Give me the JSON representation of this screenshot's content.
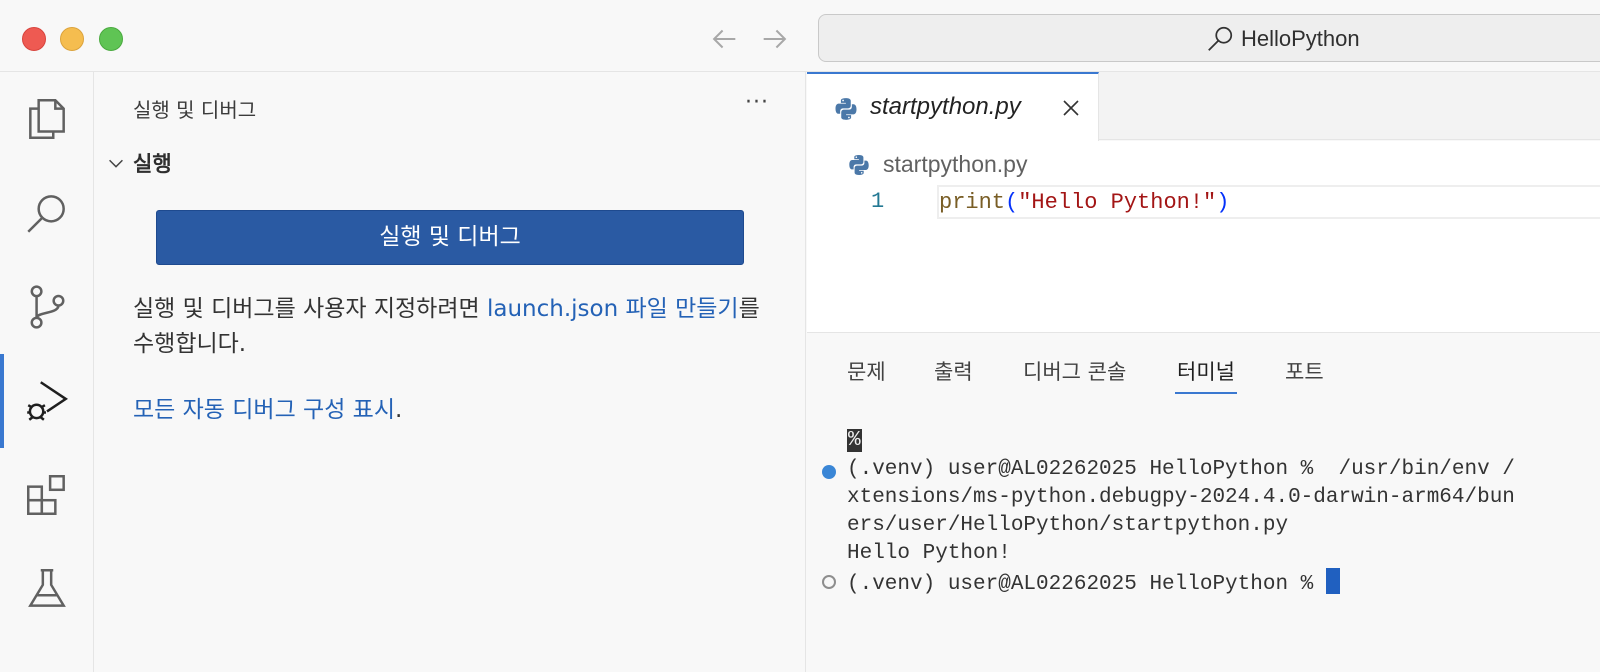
{
  "window": {
    "command_center_text": "HelloPython"
  },
  "activity_bar": {
    "items": [
      "explorer-icon",
      "search-icon",
      "source-control-icon",
      "run-debug-icon",
      "extensions-icon",
      "testing-icon"
    ],
    "active": "run-debug-icon"
  },
  "sidebar": {
    "title": "실행 및 디버그",
    "more": "···",
    "section_label": "실행",
    "run_button": "실행 및 디버그",
    "desc_pre": "실행 및 디버그를 사용자 지정하려면 ",
    "desc_link": "launch.json 파일 만들기",
    "desc_post": "를 수행합니다.",
    "auto_link": "모든 자동 디버그 구성 표시",
    "auto_post": "."
  },
  "editor": {
    "tab_name": "startpython.py",
    "breadcrumb": "startpython.py",
    "line_number": "1",
    "code": {
      "fn": "print",
      "open": "(",
      "str": "\"Hello Python!\"",
      "close": ")"
    }
  },
  "panel": {
    "tabs": [
      "문제",
      "출력",
      "디버그 콘솔",
      "터미널",
      "포트"
    ],
    "active_tab": "터미널",
    "terminal": {
      "marker": "%",
      "line1": "(.venv) user@AL02262025 HelloPython %  /usr/bin/env /",
      "line2": "xtensions/ms-python.debugpy-2024.4.0-darwin-arm64/bun",
      "line3": "ers/user/HelloPython/startpython.py",
      "line4": "Hello Python!",
      "line5": "(.venv) user@AL02262025 HelloPython % "
    }
  },
  "colors": {
    "accent": "#3a78d0",
    "button": "#2a5aa3",
    "link": "#2462b6"
  }
}
